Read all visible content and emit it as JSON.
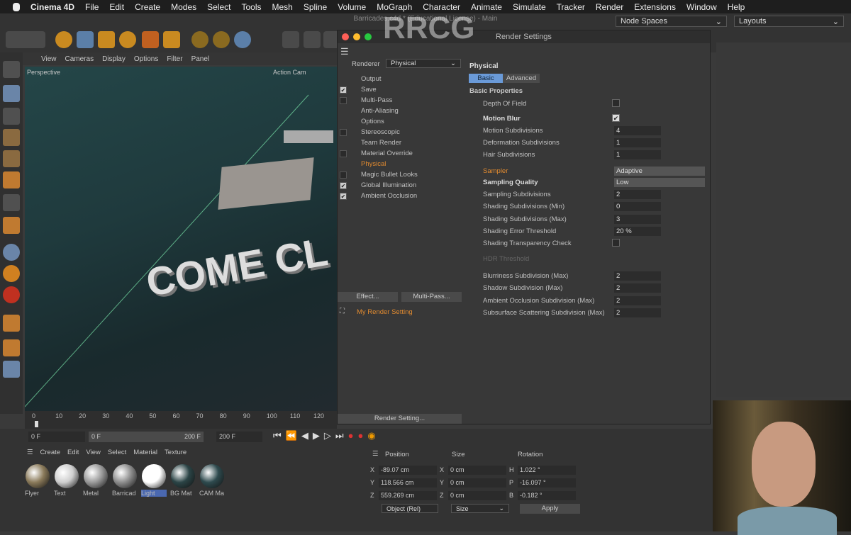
{
  "menubar": {
    "apple": "",
    "items": [
      "Cinema 4D",
      "File",
      "Edit",
      "Create",
      "Modes",
      "Select",
      "Tools",
      "Mesh",
      "Spline",
      "Volume",
      "MoGraph",
      "Character",
      "Animate",
      "Simulate",
      "Tracker",
      "Render",
      "Extensions",
      "Window",
      "Help"
    ]
  },
  "toolbar": {
    "node_spaces": "Node Spaces",
    "layouts": "Layouts",
    "doc_title": "Barricades.c4d * (Educational License) - Main"
  },
  "viewport": {
    "menu": [
      "View",
      "Cameras",
      "Display",
      "Options",
      "Filter",
      "Panel"
    ],
    "label": "Perspective",
    "camera": "Action Cam",
    "scene_text": "COME CL"
  },
  "timeline": {
    "ticks": [
      "0",
      "10",
      "20",
      "30",
      "40",
      "50",
      "60",
      "70",
      "80",
      "90",
      "100",
      "110",
      "120"
    ],
    "start": "0 F",
    "range_start": "0 F",
    "range_end": "200 F",
    "end": "200 F"
  },
  "render_window": {
    "title": "Render Settings",
    "renderer_label": "Renderer",
    "renderer_value": "Physical",
    "items": [
      {
        "label": "Output",
        "check": null
      },
      {
        "label": "Save",
        "check": true
      },
      {
        "label": "Multi-Pass",
        "check": false
      },
      {
        "label": "Anti-Aliasing",
        "check": null
      },
      {
        "label": "Options",
        "check": null
      },
      {
        "label": "Stereoscopic",
        "check": false
      },
      {
        "label": "Team Render",
        "check": null
      },
      {
        "label": "Material Override",
        "check": false
      },
      {
        "label": "Physical",
        "check": null,
        "active": true
      },
      {
        "label": "Magic Bullet Looks",
        "check": false
      },
      {
        "label": "Global Illumination",
        "check": true
      },
      {
        "label": "Ambient Occlusion",
        "check": true
      }
    ],
    "effect_button": "Effect...",
    "multipass_button": "Multi-Pass...",
    "setting_name": "My Render Setting",
    "render_setting_button": "Render Setting...",
    "section": "Physical",
    "tabs": [
      "Basic",
      "Advanced"
    ],
    "group": "Basic Properties",
    "props": [
      {
        "label": "Depth Of Field",
        "type": "check",
        "value": false
      },
      {
        "label": "Motion Blur",
        "type": "check",
        "value": true,
        "bold": true
      },
      {
        "label": "Motion Subdivisions",
        "type": "num",
        "value": "4"
      },
      {
        "label": "Deformation Subdivisions",
        "type": "num",
        "value": "1"
      },
      {
        "label": "Hair Subdivisions",
        "type": "num",
        "value": "1"
      },
      {
        "label": "Sampler",
        "type": "select",
        "value": "Adaptive",
        "orange": true
      },
      {
        "label": "Sampling Quality",
        "type": "select",
        "value": "Low",
        "bold": true
      },
      {
        "label": "Sampling Subdivisions",
        "type": "num",
        "value": "2"
      },
      {
        "label": "Shading Subdivisions (Min)",
        "type": "num",
        "value": "0"
      },
      {
        "label": "Shading Subdivisions (Max)",
        "type": "num",
        "value": "3"
      },
      {
        "label": "Shading Error Threshold",
        "type": "num",
        "value": "20 %"
      },
      {
        "label": "Shading Transparency Check",
        "type": "check",
        "value": false
      },
      {
        "label": "HDR Threshold",
        "type": "disabled",
        "value": ""
      },
      {
        "label": "Blurriness Subdivision (Max)",
        "type": "num",
        "value": "2"
      },
      {
        "label": "Shadow Subdivision (Max)",
        "type": "num",
        "value": "2"
      },
      {
        "label": "Ambient Occlusion Subdivision (Max)",
        "type": "num",
        "value": "2"
      },
      {
        "label": "Subsurface Scattering Subdivision (Max)",
        "type": "num",
        "value": "2"
      }
    ]
  },
  "materials": {
    "menu": [
      "Create",
      "Edit",
      "View",
      "Select",
      "Material",
      "Texture"
    ],
    "items": [
      {
        "name": "Flyer",
        "color": "#8a7a5a"
      },
      {
        "name": "Text",
        "color": "#cfcfcf"
      },
      {
        "name": "Metal",
        "color": "#9a9a9a"
      },
      {
        "name": "Barricad",
        "color": "#8d8d8d"
      },
      {
        "name": "Light",
        "color": "#ffffff"
      },
      {
        "name": "BG Mat",
        "color": "#2b4446"
      },
      {
        "name": "CAM Ma",
        "color": "#2e4a4e"
      }
    ]
  },
  "coords": {
    "headers": [
      "Position",
      "Size",
      "Rotation"
    ],
    "rows": [
      [
        "X",
        "-89.07 cm",
        "X",
        "0 cm",
        "H",
        "1.022 °"
      ],
      [
        "Y",
        "118.566 cm",
        "Y",
        "0 cm",
        "P",
        "-16.097 °"
      ],
      [
        "Z",
        "559.269 cm",
        "Z",
        "0 cm",
        "B",
        "-0.182 °"
      ]
    ],
    "mode": "Object (Rel)",
    "size_mode": "Size",
    "apply": "Apply"
  },
  "watermark": "RRCG"
}
